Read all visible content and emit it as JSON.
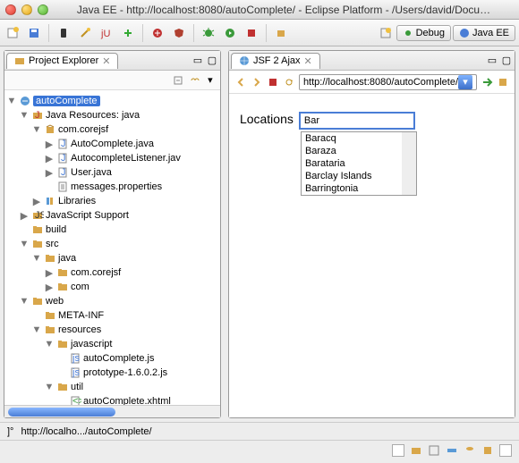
{
  "window": {
    "title": "Java EE - http://localhost:8080/autoComplete/ - Eclipse Platform - /Users/david/Docu…"
  },
  "perspectives": {
    "debug": "Debug",
    "javaee": "Java EE"
  },
  "left_panel": {
    "tab": "Project Explorer",
    "tree": [
      {
        "d": 0,
        "tw": "▼",
        "ic": "proj",
        "label": "autoComplete",
        "sel": true
      },
      {
        "d": 1,
        "tw": "▼",
        "ic": "jres",
        "label": "Java Resources: java"
      },
      {
        "d": 2,
        "tw": "▼",
        "ic": "pkg",
        "label": "com.corejsf"
      },
      {
        "d": 3,
        "tw": "▶",
        "ic": "java",
        "label": "AutoComplete.java"
      },
      {
        "d": 3,
        "tw": "▶",
        "ic": "java",
        "label": "AutocompleteListener.jav"
      },
      {
        "d": 3,
        "tw": "▶",
        "ic": "java",
        "label": "User.java"
      },
      {
        "d": 3,
        "tw": "",
        "ic": "prop",
        "label": "messages.properties"
      },
      {
        "d": 2,
        "tw": "▶",
        "ic": "lib",
        "label": "Libraries"
      },
      {
        "d": 1,
        "tw": "▶",
        "ic": "js",
        "label": "JavaScript Support"
      },
      {
        "d": 1,
        "tw": "",
        "ic": "fld",
        "label": "build"
      },
      {
        "d": 1,
        "tw": "▼",
        "ic": "fld",
        "label": "src"
      },
      {
        "d": 2,
        "tw": "▼",
        "ic": "fld",
        "label": "java"
      },
      {
        "d": 3,
        "tw": "▶",
        "ic": "fld",
        "label": "com.corejsf"
      },
      {
        "d": 3,
        "tw": "▶",
        "ic": "fld",
        "label": "com"
      },
      {
        "d": 1,
        "tw": "▼",
        "ic": "fld",
        "label": "web"
      },
      {
        "d": 2,
        "tw": "",
        "ic": "fld",
        "label": "META-INF"
      },
      {
        "d": 2,
        "tw": "▼",
        "ic": "fld",
        "label": "resources"
      },
      {
        "d": 3,
        "tw": "▼",
        "ic": "fld",
        "label": "javascript"
      },
      {
        "d": 4,
        "tw": "",
        "ic": "jsf",
        "label": "autoComplete.js"
      },
      {
        "d": 4,
        "tw": "",
        "ic": "jsf",
        "label": "prototype-1.6.0.2.js"
      },
      {
        "d": 3,
        "tw": "▼",
        "ic": "fld",
        "label": "util"
      },
      {
        "d": 4,
        "tw": "",
        "ic": "xml",
        "label": "autoComplete.xhtml"
      }
    ]
  },
  "right_panel": {
    "tab": "JSF 2 Ajax",
    "address": "http://localhost:8080/autoComplete/",
    "locations_label": "Locations",
    "input_value": "Bar",
    "suggestions": [
      "Baracq",
      "Baraza",
      "Barataria",
      "Barclay Islands",
      "Barringtonia"
    ]
  },
  "status": {
    "url": "http://localho.../autoComplete/"
  }
}
